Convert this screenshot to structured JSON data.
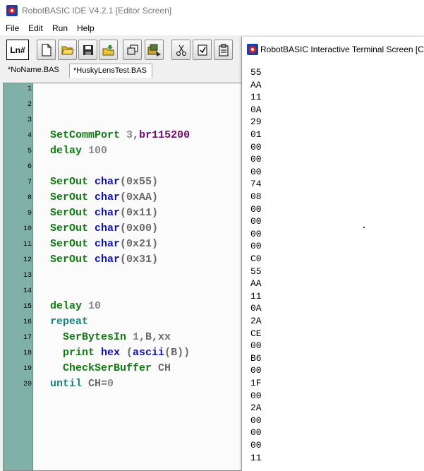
{
  "window": {
    "title": "RobotBASIC IDE V4.2.1 [Editor Screen]"
  },
  "menu": {
    "items": [
      "File",
      "Edit",
      "Run",
      "Help"
    ]
  },
  "toolbar": {
    "ln_label": "Ln#",
    "buttons": [
      "new-file-icon",
      "open-folder-icon",
      "save-icon",
      "open-project-icon",
      "copy-windows-icon",
      "run-program-icon",
      "cut-icon",
      "paste-icon",
      "clipboard-icon"
    ]
  },
  "tabs": [
    "*NoName.BAS",
    "*HuskyLensTest.BAS"
  ],
  "editor": {
    "line_numbers": [
      "1",
      "2",
      "3",
      "4",
      "5",
      "6",
      "7",
      "8",
      "9",
      "10",
      "11",
      "12",
      "13",
      "14",
      "15",
      "16",
      "17",
      "18",
      "19",
      "20"
    ],
    "lines": [
      [],
      [],
      [],
      [
        {
          "t": "SetCommPort ",
          "c": "kw"
        },
        {
          "t": "3",
          "c": "num"
        },
        {
          "t": ",",
          "c": "plain"
        },
        {
          "t": "br115200",
          "c": "purple"
        }
      ],
      [
        {
          "t": "delay ",
          "c": "kw"
        },
        {
          "t": "100",
          "c": "num"
        }
      ],
      [],
      [
        {
          "t": "SerOut ",
          "c": "kw"
        },
        {
          "t": "char",
          "c": "blue"
        },
        {
          "t": "(0x55)",
          "c": "plain"
        }
      ],
      [
        {
          "t": "SerOut ",
          "c": "kw"
        },
        {
          "t": "char",
          "c": "blue"
        },
        {
          "t": "(0xAA)",
          "c": "plain"
        }
      ],
      [
        {
          "t": "SerOut ",
          "c": "kw"
        },
        {
          "t": "char",
          "c": "blue"
        },
        {
          "t": "(0x11)",
          "c": "plain"
        }
      ],
      [
        {
          "t": "SerOut ",
          "c": "kw"
        },
        {
          "t": "char",
          "c": "blue"
        },
        {
          "t": "(0x00)",
          "c": "plain"
        }
      ],
      [
        {
          "t": "SerOut ",
          "c": "kw"
        },
        {
          "t": "char",
          "c": "blue"
        },
        {
          "t": "(0x21)",
          "c": "plain"
        }
      ],
      [
        {
          "t": "SerOut ",
          "c": "kw"
        },
        {
          "t": "char",
          "c": "blue"
        },
        {
          "t": "(0x31)",
          "c": "plain"
        }
      ],
      [],
      [],
      [
        {
          "t": "delay ",
          "c": "kw"
        },
        {
          "t": "10",
          "c": "num"
        }
      ],
      [
        {
          "t": "repeat",
          "c": "teal"
        }
      ],
      [
        {
          "t": "  SerBytesIn ",
          "c": "kw"
        },
        {
          "t": "1",
          "c": "num"
        },
        {
          "t": ",B,xx",
          "c": "plain"
        }
      ],
      [
        {
          "t": "  print ",
          "c": "kw"
        },
        {
          "t": "hex ",
          "c": "blue"
        },
        {
          "t": "(",
          "c": "plain"
        },
        {
          "t": "ascii",
          "c": "blue"
        },
        {
          "t": "(B))",
          "c": "plain"
        }
      ],
      [
        {
          "t": "  CheckSerBuffer ",
          "c": "kw"
        },
        {
          "t": "CH",
          "c": "plain"
        }
      ],
      [
        {
          "t": "until ",
          "c": "teal"
        },
        {
          "t": "CH=",
          "c": "plain"
        },
        {
          "t": "0",
          "c": "num"
        }
      ]
    ]
  },
  "terminal": {
    "title": "RobotBASIC Interactive Terminal Screen  [C:\\",
    "output": [
      "55",
      "AA",
      "11",
      "0A",
      "29",
      "01",
      "00",
      "00",
      "00",
      "74",
      "08",
      "00",
      "00",
      "00",
      "00",
      "C0",
      "55",
      "AA",
      "11",
      "0A",
      "2A",
      "CE",
      "00",
      "B6",
      "00",
      "1F",
      "00",
      "2A",
      "00",
      "00",
      "00",
      "11"
    ]
  },
  "colors": {
    "gutter": "#7fb1a8",
    "keyword": "#117a11",
    "function": "#1010b8",
    "number": "#8a8a8a",
    "constant": "#700a70",
    "control": "#1a8080"
  }
}
